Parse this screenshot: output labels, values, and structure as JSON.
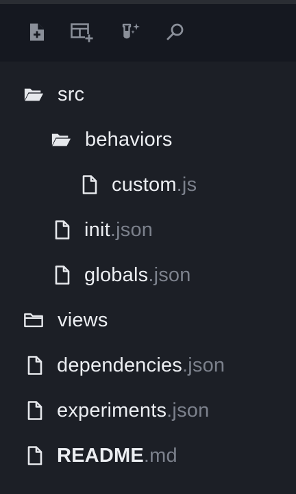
{
  "toolbar": {
    "buttons": [
      {
        "name": "new-file",
        "icon": "file-plus-icon"
      },
      {
        "name": "new-component",
        "icon": "grid-plus-icon"
      },
      {
        "name": "experiments",
        "icon": "flask-sparkle-icon"
      },
      {
        "name": "search",
        "icon": "search-icon"
      }
    ]
  },
  "tree": {
    "items": [
      {
        "name": "src",
        "ext": "",
        "type": "folder-open",
        "depth": 0
      },
      {
        "name": "behaviors",
        "ext": "",
        "type": "folder-open",
        "depth": 1
      },
      {
        "name": "custom",
        "ext": ".js",
        "type": "file",
        "depth": 2
      },
      {
        "name": "init",
        "ext": ".json",
        "type": "file",
        "depth": 1
      },
      {
        "name": "globals",
        "ext": ".json",
        "type": "file",
        "depth": 1
      },
      {
        "name": "views",
        "ext": "",
        "type": "folder",
        "depth": 0
      },
      {
        "name": "dependencies",
        "ext": ".json",
        "type": "file",
        "depth": 0
      },
      {
        "name": "experiments",
        "ext": ".json",
        "type": "file",
        "depth": 0
      },
      {
        "name": "README",
        "ext": ".md",
        "type": "file",
        "depth": 0,
        "bold": true
      }
    ]
  },
  "colors": {
    "background": "#1c1f26",
    "toolbar": "#151820",
    "text": "#eceef2",
    "extension": "#7c818c",
    "icon": "#e6e8ec",
    "toolbar_icon": "#8a8f99"
  }
}
